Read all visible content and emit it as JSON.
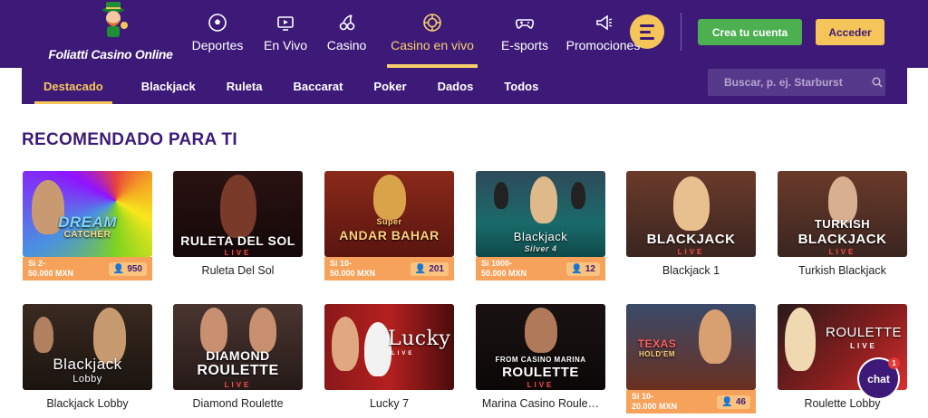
{
  "header": {
    "brand": "Foliatti Casino Online",
    "nav": [
      {
        "label": "Deportes",
        "icon": "soccer-ball-icon",
        "active": false
      },
      {
        "label": "En Vivo",
        "icon": "live-tv-icon",
        "active": false
      },
      {
        "label": "Casino",
        "icon": "cherries-icon",
        "active": false
      },
      {
        "label": "Casino en vivo",
        "icon": "casino-chip-icon",
        "active": true
      },
      {
        "label": "E-sports",
        "icon": "gamepad-icon",
        "active": false
      },
      {
        "label": "Promociones",
        "icon": "megaphone-icon",
        "active": false
      }
    ],
    "create_account": "Crea tu cuenta",
    "login": "Acceder"
  },
  "subnav": {
    "tabs": [
      {
        "label": "Destacado",
        "active": true
      },
      {
        "label": "Blackjack",
        "active": false
      },
      {
        "label": "Ruleta",
        "active": false
      },
      {
        "label": "Baccarat",
        "active": false
      },
      {
        "label": "Poker",
        "active": false
      },
      {
        "label": "Dados",
        "active": false
      },
      {
        "label": "Todos",
        "active": false
      }
    ],
    "search_placeholder": "Buscar, p. ej. Starburst"
  },
  "section_title": "RECOMENDADO PARA TI",
  "games": [
    {
      "label": "",
      "art": "DREAM",
      "art2": "CATCHER",
      "bet_line1": "Si 2-",
      "bet_line2": "50.000 MXN",
      "players": "950"
    },
    {
      "label": "Ruleta Del Sol",
      "art": "RULETA DEL SOL",
      "live": "LIVE"
    },
    {
      "label": "",
      "art": "ANDAR BAHAR",
      "art_top": "Super",
      "bet_line1": "Si 10-",
      "bet_line2": "50.000 MXN",
      "players": "201"
    },
    {
      "label": "",
      "art": "Blackjack",
      "art2": "Silver 4",
      "bet_line1": "Si 1000-",
      "bet_line2": "50.000 MXN",
      "players": "12"
    },
    {
      "label": "Blackjack 1",
      "art": "BLACKJACK",
      "live": "LIVE"
    },
    {
      "label": "Turkish Blackjack",
      "art": "TURKISH",
      "art2": "BLACKJACK",
      "live": "LIVE"
    },
    {
      "label": "Blackjack Lobby",
      "art": "Blackjack",
      "art2": "Lobby"
    },
    {
      "label": "Diamond Roulette",
      "art": "DIAMOND",
      "art2": "ROULETTE",
      "live": "LIVE"
    },
    {
      "label": "Lucky 7",
      "art": "Lucky",
      "art_small": "LIVE"
    },
    {
      "label": "Marina Casino Roule…",
      "art_top": "FROM CASINO MARINA",
      "art": "ROULETTE",
      "live": "LIVE"
    },
    {
      "label": "",
      "art": "TEXAS",
      "art2": "HOLD'EM",
      "bet_line1": "Si 10-",
      "bet_line2": "20.000 MXN",
      "players": "46"
    },
    {
      "label": "Roulette Lobby",
      "art": "ROULETTE",
      "live": "LIVE"
    }
  ],
  "chat": {
    "label": "chat",
    "badge": "1"
  },
  "colors": {
    "primary": "#3d1a78",
    "accent": "#f5c55a",
    "green": "#4caf50",
    "bet_strip": "#f7a25a"
  }
}
